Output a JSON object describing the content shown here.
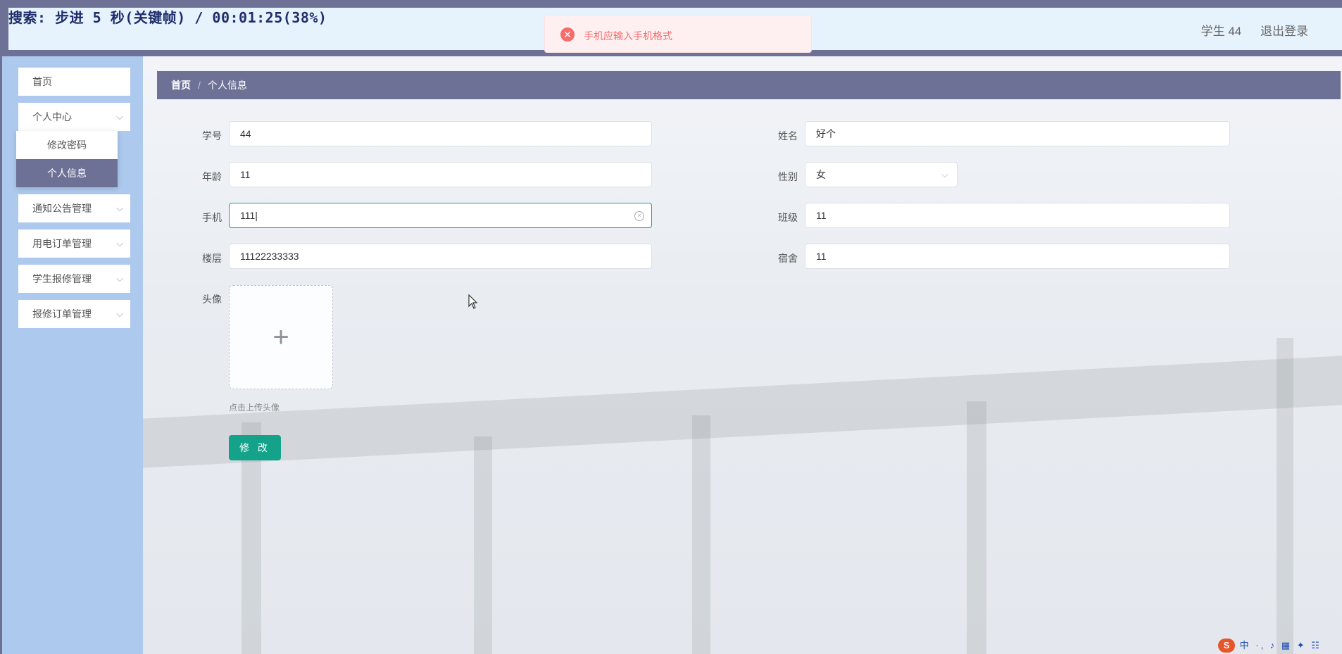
{
  "overlay": {
    "text": "搜索: 步进 5 秒(关键帧) / 00:01:25(38%)"
  },
  "header": {
    "user": "学生 44",
    "logout": "退出登录"
  },
  "toast": {
    "message": "手机应输入手机格式"
  },
  "sidebar": {
    "items": [
      {
        "label": "首页"
      },
      {
        "label": "个人中心"
      },
      {
        "label": "通知公告管理"
      },
      {
        "label": "用电订单管理"
      },
      {
        "label": "学生报修管理"
      },
      {
        "label": "报修订单管理"
      }
    ],
    "submenu": [
      {
        "label": "修改密码"
      },
      {
        "label": "个人信息"
      }
    ]
  },
  "breadcrumb": {
    "home": "首页",
    "separator": "/",
    "current": "个人信息"
  },
  "form": {
    "student_id": {
      "label": "学号",
      "value": "44"
    },
    "name": {
      "label": "姓名",
      "value": "好个"
    },
    "age": {
      "label": "年龄",
      "value": "11"
    },
    "gender": {
      "label": "性别",
      "value": "女"
    },
    "phone": {
      "label": "手机",
      "value": "111|"
    },
    "class": {
      "label": "班级",
      "value": "11"
    },
    "floor": {
      "label": "楼层",
      "value": "11122233333"
    },
    "dorm": {
      "label": "宿舍",
      "value": "11"
    },
    "avatar": {
      "label": "头像",
      "tip": "点击上传头像"
    },
    "submit": "修 改"
  },
  "tray": {
    "logo": "S",
    "glyphs": "中 ·, ♪ ▦ ✦ ☷"
  },
  "colors": {
    "primary": "#6e7196",
    "accent": "#14a38a",
    "error": "#f56c6c",
    "sidebar": "#adc9ee"
  }
}
